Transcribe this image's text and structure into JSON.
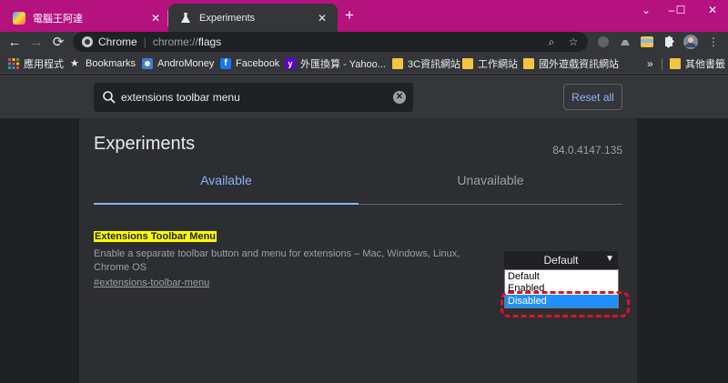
{
  "tabs": [
    {
      "title": "電腦王阿達"
    },
    {
      "title": "Experiments"
    }
  ],
  "omnibox": {
    "site": "Chrome",
    "scheme": "chrome://",
    "path": "flags"
  },
  "bookmarks": [
    {
      "label": "應用程式",
      "icon": "apps-grid-icon"
    },
    {
      "label": "Bookmarks",
      "icon": "star-icon"
    },
    {
      "label": "AndroMoney",
      "icon": "andromoney-icon"
    },
    {
      "label": "Facebook",
      "icon": "facebook-icon"
    },
    {
      "label": "外匯換算 - Yahoo...",
      "icon": "yahoo-icon"
    },
    {
      "label": "3C資訊網站",
      "icon": "folder-icon"
    },
    {
      "label": "工作網站",
      "icon": "folder-icon"
    },
    {
      "label": "國外遊戲資訊網站",
      "icon": "folder-icon"
    },
    {
      "label": "其他書籤",
      "icon": "folder-icon"
    }
  ],
  "bookmarks_overflow": "»",
  "search": {
    "value": "extensions toolbar menu"
  },
  "reset_label": "Reset all",
  "page_title": "Experiments",
  "version": "84.0.4147.135",
  "page_tabs": {
    "available": "Available",
    "unavailable": "Unavailable"
  },
  "flag": {
    "name": "Extensions Toolbar Menu",
    "description": "Enable a separate toolbar button and menu for extensions – Mac, Windows, Linux, Chrome OS",
    "link": "#extensions-toolbar-menu",
    "selected": "Default",
    "options": [
      "Default",
      "Enabled",
      "Disabled"
    ]
  },
  "colors": {
    "tabstrip": "#b5117f",
    "accent": "#8ab4f8",
    "highlight": "#ffff00",
    "ring": "#e0102c"
  }
}
